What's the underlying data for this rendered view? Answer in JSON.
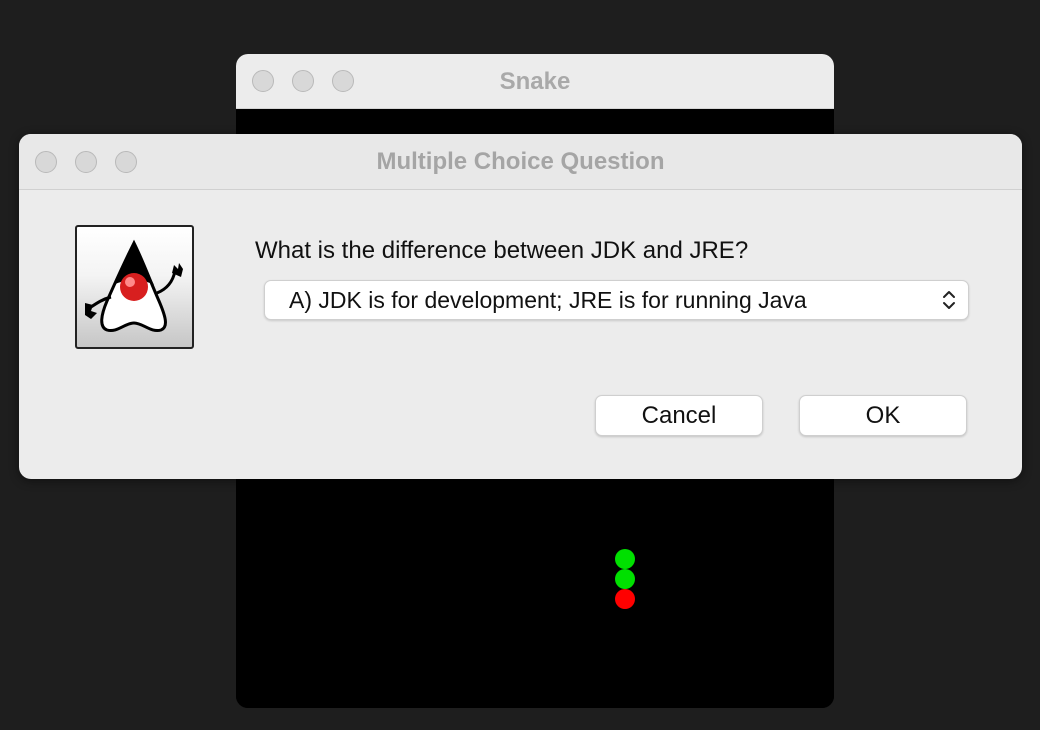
{
  "snake_window": {
    "title": "Snake",
    "snake_colors": {
      "head": "#ff0000",
      "body": "#00e000"
    }
  },
  "dialog": {
    "title": "Multiple Choice Question",
    "question": "What is the difference between JDK and JRE?",
    "selected_answer": "A) JDK is for development; JRE is for running Java",
    "cancel_label": "Cancel",
    "ok_label": "OK",
    "icon": "java-duke-icon"
  }
}
